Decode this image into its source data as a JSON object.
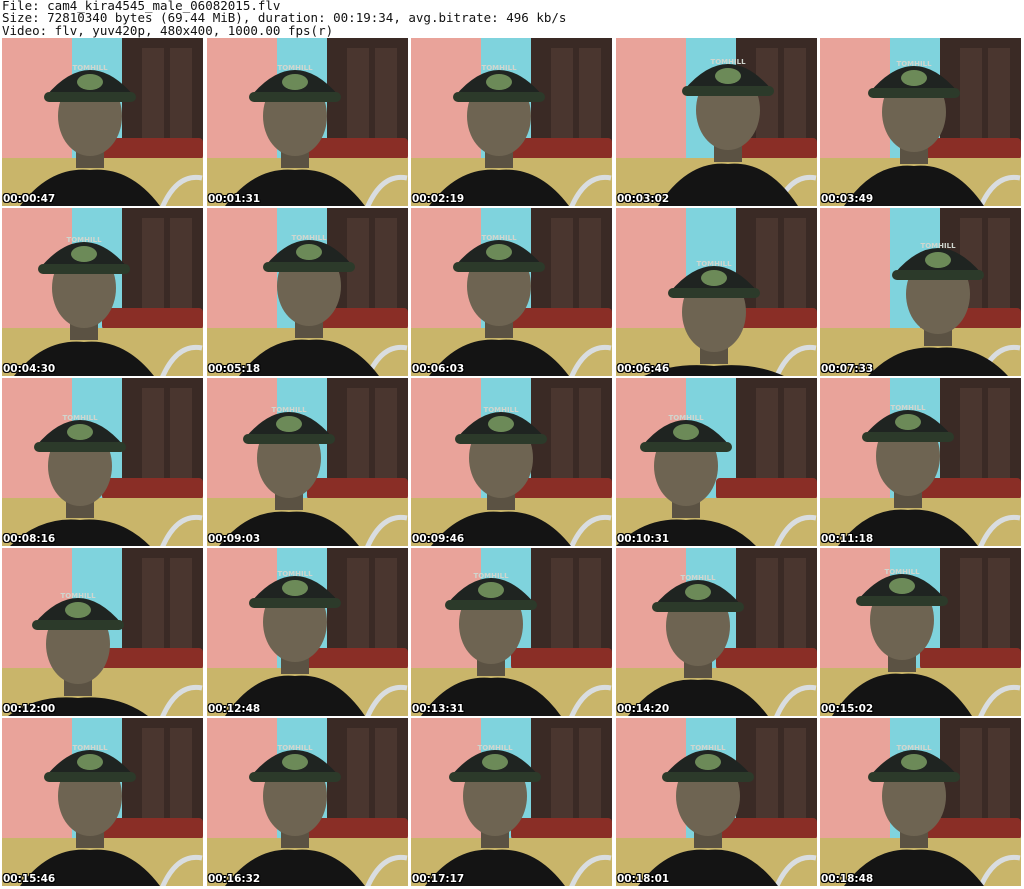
{
  "header": {
    "file_line": "File: cam4_kira4545_male_06082015.flv",
    "size_line": "Size: 72810340 bytes (69.44 MiB), duration: 00:19:34, avg.bitrate: 496 kb/s",
    "video_line": "Video: flv, yuv420p, 480x400, 1000.00 fps(r)"
  },
  "colors": {
    "wall_pink": "#e9a39a",
    "wall_cyan": "#7fd3dd",
    "wood_dark": "#3a2a25",
    "shirt": "#141414",
    "skin": "#6e6452",
    "cap": "#1f2421",
    "cap_logo": "#6c8a58",
    "headboard": "#8a2e26"
  },
  "thumbnails": [
    {
      "timestamp": "00:00:47",
      "cap_text": "TOMHILL"
    },
    {
      "timestamp": "00:01:31",
      "cap_text": "TOMHILL"
    },
    {
      "timestamp": "00:02:19",
      "cap_text": "TOMHILL"
    },
    {
      "timestamp": "00:03:02",
      "cap_text": "TOMHILL"
    },
    {
      "timestamp": "00:03:49",
      "cap_text": "TOMHILL"
    },
    {
      "timestamp": "00:04:30",
      "cap_text": "TOMHILL"
    },
    {
      "timestamp": "00:05:18",
      "cap_text": "TOMHILL"
    },
    {
      "timestamp": "00:06:03",
      "cap_text": "TOMHILL"
    },
    {
      "timestamp": "00:06:46",
      "cap_text": "TOMHILL"
    },
    {
      "timestamp": "00:07:33",
      "cap_text": "TOMHILL"
    },
    {
      "timestamp": "00:08:16",
      "cap_text": "TOMHILL"
    },
    {
      "timestamp": "00:09:03",
      "cap_text": "TOMHILL"
    },
    {
      "timestamp": "00:09:46",
      "cap_text": "TOMHILL"
    },
    {
      "timestamp": "00:10:31",
      "cap_text": "TOMHILL"
    },
    {
      "timestamp": "00:11:18",
      "cap_text": "TOMHILL"
    },
    {
      "timestamp": "00:12:00",
      "cap_text": "TOMHILL"
    },
    {
      "timestamp": "00:12:48",
      "cap_text": "TOMHILL"
    },
    {
      "timestamp": "00:13:31",
      "cap_text": "TOMHILL"
    },
    {
      "timestamp": "00:14:20",
      "cap_text": "TOMHILL"
    },
    {
      "timestamp": "00:15:02",
      "cap_text": "TOMHILL"
    },
    {
      "timestamp": "00:15:46",
      "cap_text": "TOMHILL"
    },
    {
      "timestamp": "00:16:32",
      "cap_text": "TOMHILL"
    },
    {
      "timestamp": "00:17:17",
      "cap_text": "TOMHILL"
    },
    {
      "timestamp": "00:18:01",
      "cap_text": "TOMHILL"
    },
    {
      "timestamp": "00:18:48",
      "cap_text": "TOMHILL"
    }
  ]
}
